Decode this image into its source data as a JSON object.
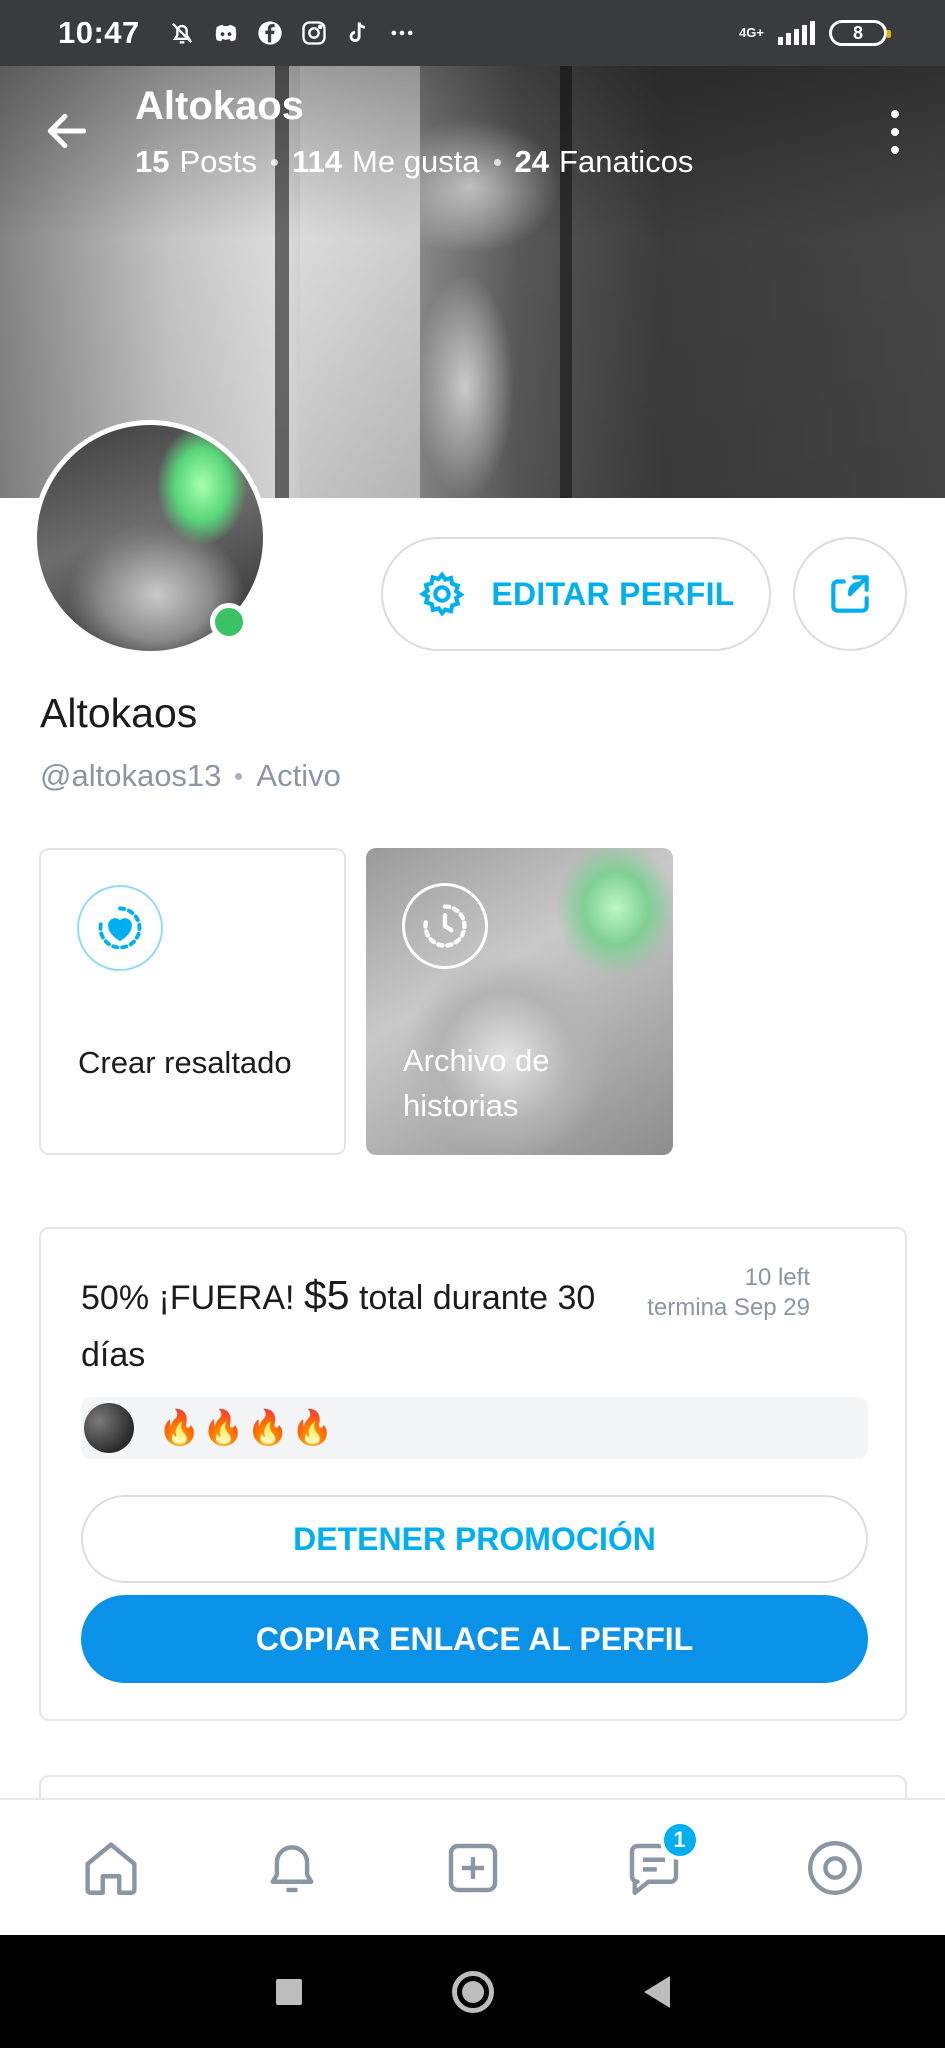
{
  "status_bar": {
    "time": "10:47",
    "network": "4G+",
    "battery": "8",
    "icons": [
      "bell-off-icon",
      "discord-icon",
      "facebook-icon",
      "instagram-icon",
      "tiktok-icon",
      "more-icon"
    ]
  },
  "header": {
    "title": "Altokaos",
    "posts_count": "15",
    "posts_label": "Posts",
    "likes_count": "114",
    "likes_label": "Me gusta",
    "fans_count": "24",
    "fans_label": "Fanaticos"
  },
  "profile": {
    "name": "Altokaos",
    "handle": "@altokaos13",
    "status": "Activo",
    "edit_label": "EDITAR PERFIL"
  },
  "highlights": [
    {
      "label": "Crear resaltado",
      "icon": "heart-progress-icon"
    },
    {
      "label": "Archivo de historias",
      "icon": "clock-history-icon"
    }
  ],
  "promo": {
    "title_prefix": "50% ¡FUERA!",
    "price": "$5",
    "title_suffix": "total durante 30 días",
    "left": "10 left",
    "ends": "termina Sep 29",
    "reactions": "🔥🔥🔥🔥",
    "stop_label": "DETENER PROMOCIÓN",
    "copy_label": "COPIAR ENLACE AL PERFIL"
  },
  "bottom_nav": {
    "items": [
      "home-icon",
      "notifications-icon",
      "add-post-icon",
      "messages-icon",
      "profile-icon"
    ],
    "messages_badge": "1"
  },
  "colors": {
    "accent": "#00aff0",
    "primary_button": "#0a92e8",
    "online": "#3cc266",
    "muted_text": "#8a96a3"
  }
}
